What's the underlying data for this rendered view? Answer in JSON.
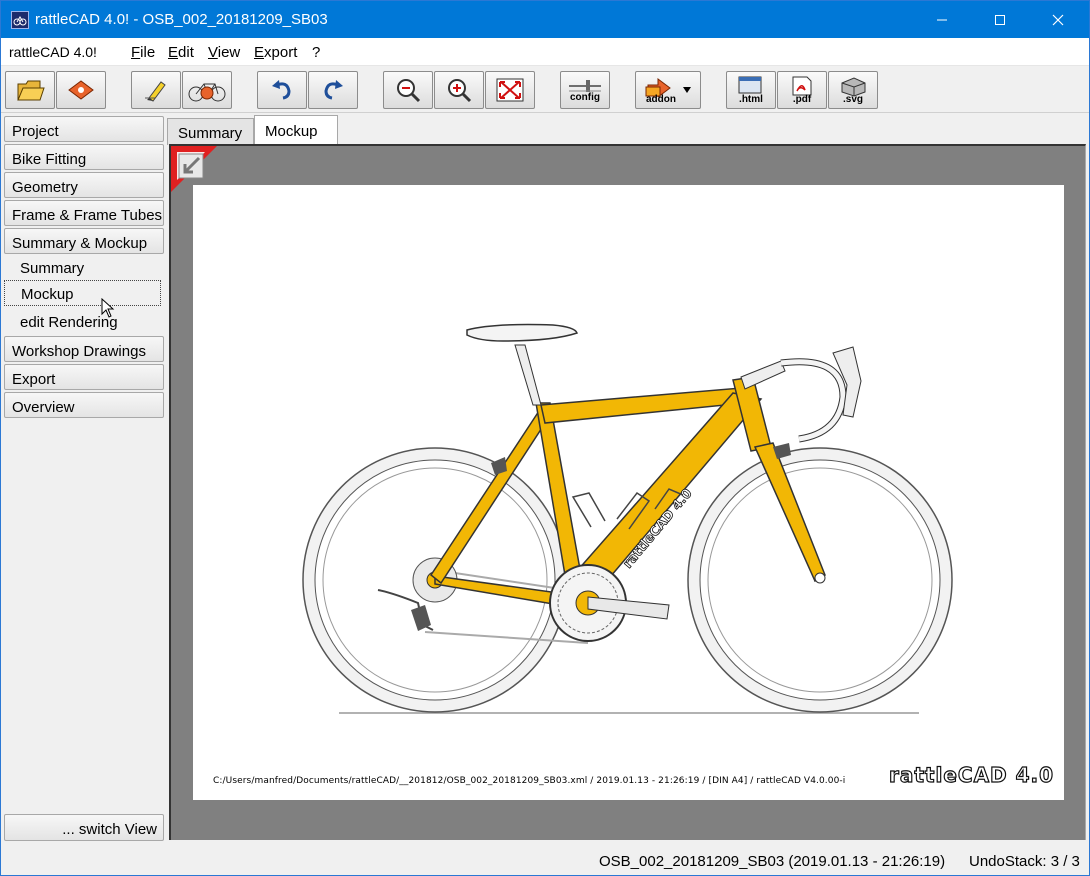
{
  "window": {
    "title": "rattleCAD 4.0!  - OSB_002_20181209_SB03",
    "app_icon": "rattlecad-icon",
    "controls": [
      "minimize-icon",
      "maximize-icon",
      "close-icon"
    ]
  },
  "menubar": {
    "app_label": "rattleCAD 4.0!",
    "items": [
      {
        "key": "F",
        "rest": "ile"
      },
      {
        "key": "E",
        "rest": "dit"
      },
      {
        "key": "V",
        "rest": "iew"
      },
      {
        "key": "E",
        "rest": "xport"
      },
      {
        "key": "",
        "rest": "?"
      }
    ]
  },
  "toolbar": {
    "buttons": [
      {
        "icon": "open-folder-icon",
        "label": ""
      },
      {
        "icon": "save-icon",
        "label": ""
      },
      {
        "icon": "edit-pen-icon",
        "label": ""
      },
      {
        "icon": "bike-icon",
        "label": ""
      },
      {
        "icon": "undo-icon",
        "label": ""
      },
      {
        "icon": "redo-icon",
        "label": ""
      },
      {
        "icon": "zoom-out-icon",
        "label": ""
      },
      {
        "icon": "zoom-in-icon",
        "label": ""
      },
      {
        "icon": "fit-to-window-icon",
        "label": ""
      },
      {
        "icon": "config-icon",
        "label": "config"
      },
      {
        "icon": "addon-icon",
        "label": "addon"
      },
      {
        "icon": "html-export-icon",
        "label": ".html"
      },
      {
        "icon": "pdf-export-icon",
        "label": ".pdf"
      },
      {
        "icon": "svg-export-icon",
        "label": ".svg"
      }
    ]
  },
  "sidebar": {
    "items": [
      {
        "label": "Project",
        "type": "button"
      },
      {
        "label": "Bike Fitting",
        "type": "button"
      },
      {
        "label": "Geometry",
        "type": "button"
      },
      {
        "label": "Frame & Frame Tubes",
        "type": "button"
      },
      {
        "label": "Summary & Mockup",
        "type": "button"
      },
      {
        "label": "Summary",
        "type": "sub"
      },
      {
        "label": "Mockup",
        "type": "sub",
        "active": true
      },
      {
        "label": "edit Rendering",
        "type": "sub"
      },
      {
        "label": "Workshop Drawings",
        "type": "button"
      },
      {
        "label": "Export",
        "type": "button"
      },
      {
        "label": "Overview",
        "type": "button"
      }
    ],
    "switch_view": "... switch View"
  },
  "tabs": [
    {
      "label": "Summary",
      "active": false
    },
    {
      "label": "Mockup",
      "active": true
    }
  ],
  "drawing": {
    "footnote": "C:/Users/manfred/Documents/rattleCAD/__201812/OSB_002_20181209_SB03.xml   /   2019.01.13 - 21:26:19   /  [DIN A4]  /   rattleCAD   V4.0.00-i",
    "downtube_decal": "rattleCAD 4.0",
    "logo_text": "rattleCAD 4.0",
    "frame_color": "#f2b705"
  },
  "status": {
    "file": "OSB_002_20181209_SB03 (2019.01.13 - 21:26:19)",
    "undo": "UndoStack:  3 /  3"
  },
  "colors": {
    "titlebar": "#0078d7",
    "canvas_bg": "#808080",
    "frame": "#f2b705",
    "corner_red": "#e02020"
  }
}
